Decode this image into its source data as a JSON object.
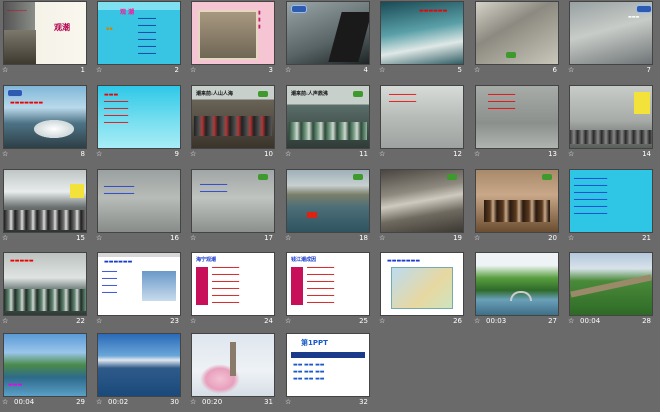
{
  "slides": [
    {
      "num": "1",
      "time": "",
      "title": "观潮"
    },
    {
      "num": "2",
      "time": "",
      "title": "观 潮"
    },
    {
      "num": "3",
      "time": "",
      "title": ""
    },
    {
      "num": "4",
      "time": "",
      "title": ""
    },
    {
      "num": "5",
      "time": "",
      "title": ""
    },
    {
      "num": "6",
      "time": "",
      "title": ""
    },
    {
      "num": "7",
      "time": "",
      "title": ""
    },
    {
      "num": "8",
      "time": "",
      "title": ""
    },
    {
      "num": "9",
      "time": "",
      "title": ""
    },
    {
      "num": "10",
      "time": "",
      "title": "潮来前:人山人海"
    },
    {
      "num": "11",
      "time": "",
      "title": "潮来前:人声鼎沸"
    },
    {
      "num": "12",
      "time": "",
      "title": ""
    },
    {
      "num": "13",
      "time": "",
      "title": ""
    },
    {
      "num": "14",
      "time": "",
      "title": ""
    },
    {
      "num": "15",
      "time": "",
      "title": ""
    },
    {
      "num": "16",
      "time": "",
      "title": ""
    },
    {
      "num": "17",
      "time": "",
      "title": ""
    },
    {
      "num": "18",
      "time": "",
      "title": ""
    },
    {
      "num": "19",
      "time": "",
      "title": ""
    },
    {
      "num": "20",
      "time": "",
      "title": ""
    },
    {
      "num": "21",
      "time": "",
      "title": ""
    },
    {
      "num": "22",
      "time": "",
      "title": ""
    },
    {
      "num": "23",
      "time": "",
      "title": ""
    },
    {
      "num": "24",
      "time": "",
      "title": "海宁观潮"
    },
    {
      "num": "25",
      "time": "",
      "title": "钱江潮成因"
    },
    {
      "num": "26",
      "time": "",
      "title": ""
    },
    {
      "num": "27",
      "time": "00:03",
      "title": ""
    },
    {
      "num": "28",
      "time": "00:04",
      "title": ""
    },
    {
      "num": "29",
      "time": "00:04",
      "title": ""
    },
    {
      "num": "30",
      "time": "00:02",
      "title": ""
    },
    {
      "num": "31",
      "time": "00:20",
      "title": ""
    },
    {
      "num": "32",
      "time": "",
      "title": "第1PPT"
    }
  ],
  "star": "☆",
  "colors": {
    "bg": "#6a6a6a",
    "caption": "#ffffff"
  }
}
